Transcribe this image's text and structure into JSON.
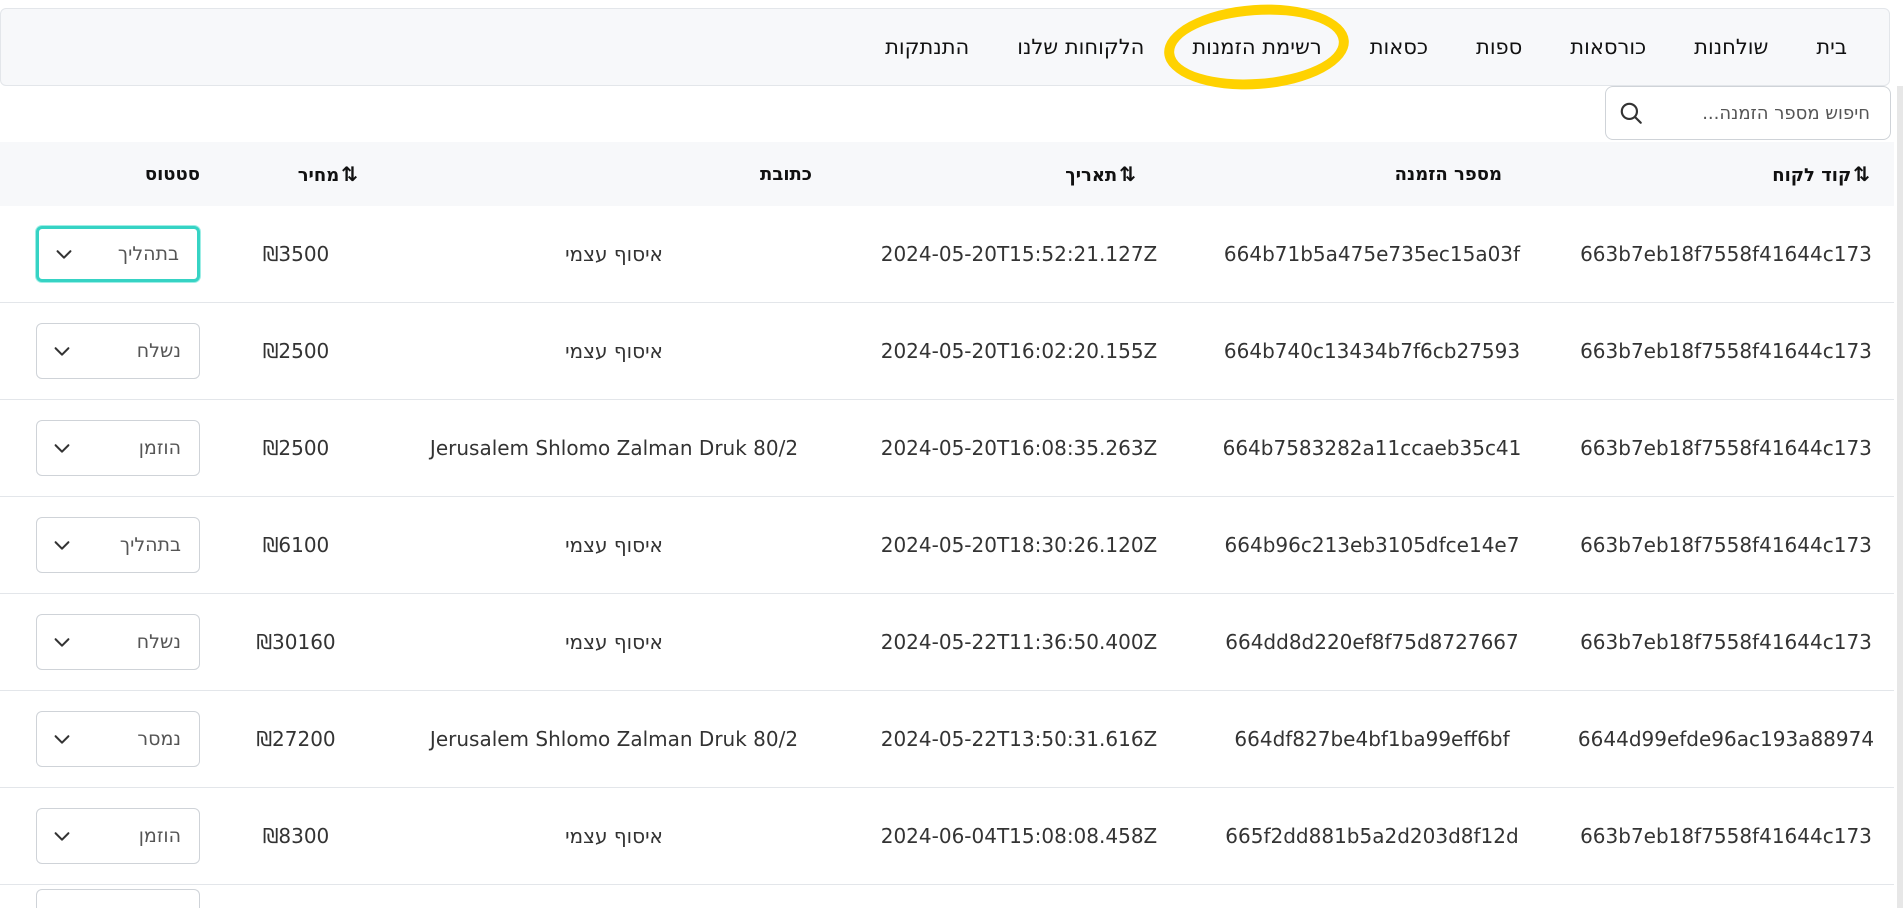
{
  "nav": {
    "items": [
      {
        "label": "בית"
      },
      {
        "label": "שולחנות"
      },
      {
        "label": "כורסאות"
      },
      {
        "label": "ספות"
      },
      {
        "label": "כסאות"
      },
      {
        "label": "רשימת הזמנות"
      },
      {
        "label": "הלקוחות שלנו"
      },
      {
        "label": "התנתקות"
      }
    ],
    "highlighted_index": 5,
    "highlight_color": "#ffd200"
  },
  "search": {
    "placeholder": "חיפוש מספר הזמנה...",
    "value": ""
  },
  "table": {
    "headers": {
      "customer_code": "קוד לקוח",
      "order_number": "מספר הזמנה",
      "date": "תאריך",
      "address": "כתובת",
      "price": "מחיר",
      "status": "סטטוס"
    },
    "sort_icon": "⇅",
    "rows": [
      {
        "customer_code": "663b7eb18f7558f41644c173",
        "order_number": "664b71b5a475e735ec15a03f",
        "date": "2024-05-20T15:52:21.127Z",
        "address": "איסוף עצמי",
        "price": "₪3500",
        "status": "בתהליך"
      },
      {
        "customer_code": "663b7eb18f7558f41644c173",
        "order_number": "664b740c13434b7f6cb27593",
        "date": "2024-05-20T16:02:20.155Z",
        "address": "איסוף עצמי",
        "price": "₪2500",
        "status": "נשלח"
      },
      {
        "customer_code": "663b7eb18f7558f41644c173",
        "order_number": "664b7583282a11ccaeb35c41",
        "date": "2024-05-20T16:08:35.263Z",
        "address": "Jerusalem Shlomo Zalman Druk 80/2",
        "price": "₪2500",
        "status": "הוזמן"
      },
      {
        "customer_code": "663b7eb18f7558f41644c173",
        "order_number": "664b96c213eb3105dfce14e7",
        "date": "2024-05-20T18:30:26.120Z",
        "address": "איסוף עצמי",
        "price": "₪6100",
        "status": "בתהליך"
      },
      {
        "customer_code": "663b7eb18f7558f41644c173",
        "order_number": "664dd8d220ef8f75d8727667",
        "date": "2024-05-22T11:36:50.400Z",
        "address": "איסוף עצמי",
        "price": "₪30160",
        "status": "נשלח"
      },
      {
        "customer_code": "6644d99efde96ac193a88974",
        "order_number": "664df827be4bf1ba99eff6bf",
        "date": "2024-05-22T13:50:31.616Z",
        "address": "Jerusalem Shlomo Zalman Druk 80/2",
        "price": "₪27200",
        "status": "נמסר"
      },
      {
        "customer_code": "663b7eb18f7558f41644c173",
        "order_number": "665f2dd881b5a2d203d8f12d",
        "date": "2024-06-04T15:08:08.458Z",
        "address": "איסוף עצמי",
        "price": "₪8300",
        "status": "הוזמן"
      }
    ],
    "focused_status_row": 0
  },
  "colors": {
    "focus_ring": "#36d3c4",
    "header_bg": "#f7f8fa"
  }
}
